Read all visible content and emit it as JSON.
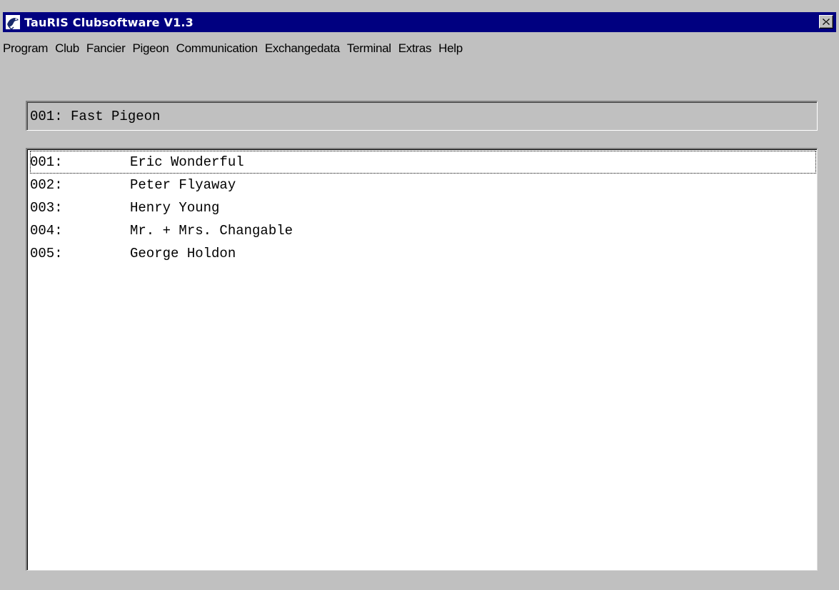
{
  "window": {
    "title": "TauRIS Clubsoftware  V1.3",
    "app_icon": "pigeon-icon",
    "close_icon": "close-icon"
  },
  "menu": [
    {
      "label": "Program"
    },
    {
      "label": "Club"
    },
    {
      "label": "Fancier"
    },
    {
      "label": "Pigeon"
    },
    {
      "label": "Communication"
    },
    {
      "label": "Exchangedata"
    },
    {
      "label": "Terminal"
    },
    {
      "label": "Extras"
    },
    {
      "label": "Help"
    }
  ],
  "club_field": {
    "value": "001: Fast Pigeon"
  },
  "fanciers": [
    {
      "num": "001:",
      "name": "Eric Wonderful",
      "focused": true
    },
    {
      "num": "002:",
      "name": "Peter Flyaway",
      "focused": false
    },
    {
      "num": "003:",
      "name": "Henry Young",
      "focused": false
    },
    {
      "num": "004:",
      "name": "Mr. + Mrs. Changable",
      "focused": false
    },
    {
      "num": "005:",
      "name": "George Holdon",
      "focused": false
    }
  ],
  "colors": {
    "titlebar": "#000080",
    "face": "#c0c0c0",
    "list_background": "#ffffff"
  }
}
